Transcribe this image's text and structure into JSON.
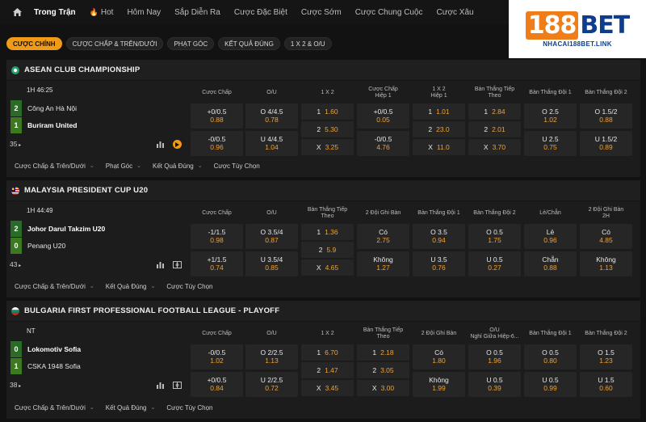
{
  "nav": {
    "items": [
      {
        "label": "Trong Trận",
        "active": true
      },
      {
        "label": "Hot",
        "hot": true
      },
      {
        "label": "Hôm Nay"
      },
      {
        "label": "Sắp Diễn Ra"
      },
      {
        "label": "Cược Đặc Biệt"
      },
      {
        "label": "Cược Sớm"
      },
      {
        "label": "Cược Chung Cuộc"
      },
      {
        "label": "Cược Xâu"
      }
    ]
  },
  "logo": {
    "num": "188",
    "word": "BET",
    "sub": "NHACAI188BET.LINK"
  },
  "filters": [
    "CƯỢC CHÍNH",
    "CƯỢC CHẤP & TRÊN/DƯỚI",
    "PHẠT GÓC",
    "KẾT QUẢ ĐÚNG",
    "1 X 2 & O/U"
  ],
  "leagues": [
    {
      "name": "ASEAN CLUB CHAMPIONSHIP",
      "time": "1H 46:25",
      "teams": [
        {
          "name": "Công An Hà Nội",
          "score": "2",
          "bold": false
        },
        {
          "name": "Buriram United",
          "score": "1",
          "bold": true
        }
      ],
      "more": "35",
      "headers": [
        "Cược Chấp",
        "O/U",
        "1 X 2",
        "Cược Chấp\nHiệp 1",
        "1 X 2\nHiệp 1",
        "Bàn Thắng Tiếp\nTheo",
        "Bàn Thắng Đội 1",
        "Bàn Thắng Đội 2"
      ],
      "cells": [
        [
          {
            "lbl": "+0/0.5",
            "odd": "0.88"
          },
          {
            "lbl": "-0/0.5",
            "odd": "0.96"
          }
        ],
        [
          {
            "lbl": "O 4/4.5",
            "odd": "0.78"
          },
          {
            "lbl": "U 4/4.5",
            "odd": "1.04"
          }
        ],
        [
          {
            "lbl": "1",
            "odd": "1.60"
          },
          {
            "lbl": "2",
            "odd": "5.30"
          },
          {
            "lbl": "X",
            "odd": "3.25"
          }
        ],
        [
          {
            "lbl": "+0/0.5",
            "odd": "0.05"
          },
          {
            "lbl": "-0/0.5",
            "odd": "4.76"
          }
        ],
        [
          {
            "lbl": "1",
            "odd": "1.01"
          },
          {
            "lbl": "2",
            "odd": "23.0"
          },
          {
            "lbl": "X",
            "odd": "11.0"
          }
        ],
        [
          {
            "lbl": "1",
            "odd": "2.84"
          },
          {
            "lbl": "2",
            "odd": "2.01"
          },
          {
            "lbl": "X",
            "odd": "3.70"
          }
        ],
        [
          {
            "lbl": "O 2.5",
            "odd": "1.02"
          },
          {
            "lbl": "U 2.5",
            "odd": "0.75"
          }
        ],
        [
          {
            "lbl": "O 1.5/2",
            "odd": "0.88"
          },
          {
            "lbl": "U 1.5/2",
            "odd": "0.89"
          }
        ]
      ],
      "sub": [
        "Cược Chấp & Trên/Dưới",
        "Phạt Góc",
        "Kết Quả Đúng",
        "Cược Tùy Chọn"
      ]
    },
    {
      "name": "MALAYSIA PRESIDENT CUP U20",
      "time": "1H 44:49",
      "teams": [
        {
          "name": "Johor Darul Takzim U20",
          "score": "2",
          "bold": true
        },
        {
          "name": "Penang U20",
          "score": "0",
          "bold": false
        }
      ],
      "more": "43",
      "headers": [
        "Cược Chấp",
        "O/U",
        "Bàn Thắng Tiếp\nTheo",
        "2 Đội Ghi Bàn",
        "Bàn Thắng Đội 1",
        "Bàn Thắng Đội 2",
        "Lẻ/Chẵn",
        "2 Đội Ghi Bàn\n2H"
      ],
      "cells": [
        [
          {
            "lbl": "-1/1.5",
            "odd": "0.98"
          },
          {
            "lbl": "+1/1.5",
            "odd": "0.74"
          }
        ],
        [
          {
            "lbl": "O 3.5/4",
            "odd": "0.87"
          },
          {
            "lbl": "U 3.5/4",
            "odd": "0.85"
          }
        ],
        [
          {
            "lbl": "1",
            "odd": "1.36"
          },
          {
            "lbl": "2",
            "odd": "5.9"
          },
          {
            "lbl": "X",
            "odd": "4.65"
          }
        ],
        [
          {
            "lbl": "Có",
            "odd": "2.75"
          },
          {
            "lbl": "Không",
            "odd": "1.27"
          }
        ],
        [
          {
            "lbl": "O 3.5",
            "odd": "0.94"
          },
          {
            "lbl": "U 3.5",
            "odd": "0.76"
          }
        ],
        [
          {
            "lbl": "O 0.5",
            "odd": "1.75"
          },
          {
            "lbl": "U 0.5",
            "odd": "0.27"
          }
        ],
        [
          {
            "lbl": "Lẻ",
            "odd": "0.96"
          },
          {
            "lbl": "Chẵn",
            "odd": "0.88"
          }
        ],
        [
          {
            "lbl": "Có",
            "odd": "4.85"
          },
          {
            "lbl": "Không",
            "odd": "1.13"
          }
        ]
      ],
      "sub": [
        "Cược Chấp & Trên/Dưới",
        "Kết Quả Đúng",
        "Cược Tùy Chọn"
      ]
    },
    {
      "name": "BULGARIA FIRST PROFESSIONAL FOOTBALL LEAGUE - PLAYOFF",
      "time": "NT",
      "teams": [
        {
          "name": "Lokomotiv Sofia",
          "score": "0",
          "bold": true
        },
        {
          "name": "CSKA 1948 Sofia",
          "score": "1",
          "bold": false
        }
      ],
      "more": "38",
      "headers": [
        "Cược Chấp",
        "O/U",
        "1 X 2",
        "Bàn Thắng Tiếp\nTheo",
        "2 Đội Ghi Bàn",
        "O/U\nNghỉ Giữa Hiệp-6...",
        "Bàn Thắng Đội 1",
        "Bàn Thắng Đội 2"
      ],
      "cells": [
        [
          {
            "lbl": "-0/0.5",
            "odd": "1.02"
          },
          {
            "lbl": "+0/0.5",
            "odd": "0.84"
          }
        ],
        [
          {
            "lbl": "O 2/2.5",
            "odd": "1.13"
          },
          {
            "lbl": "U 2/2.5",
            "odd": "0.72"
          }
        ],
        [
          {
            "lbl": "1",
            "odd": "6.70"
          },
          {
            "lbl": "2",
            "odd": "1.47"
          },
          {
            "lbl": "X",
            "odd": "3.45"
          }
        ],
        [
          {
            "lbl": "1",
            "odd": "2.18"
          },
          {
            "lbl": "2",
            "odd": "3.05"
          },
          {
            "lbl": "X",
            "odd": "3.00"
          }
        ],
        [
          {
            "lbl": "Có",
            "odd": "1.80"
          },
          {
            "lbl": "Không",
            "odd": "1.99"
          }
        ],
        [
          {
            "lbl": "O 0.5",
            "odd": "1.96"
          },
          {
            "lbl": "U 0.5",
            "odd": "0.39"
          }
        ],
        [
          {
            "lbl": "O 0.5",
            "odd": "0.80"
          },
          {
            "lbl": "U 0.5",
            "odd": "0.99"
          }
        ],
        [
          {
            "lbl": "O 1.5",
            "odd": "1.23"
          },
          {
            "lbl": "U 1.5",
            "odd": "0.60"
          }
        ]
      ],
      "sub": [
        "Cược Chấp & Trên/Dưới",
        "Kết Quả Đúng",
        "Cược Tùy Chọn"
      ]
    }
  ]
}
